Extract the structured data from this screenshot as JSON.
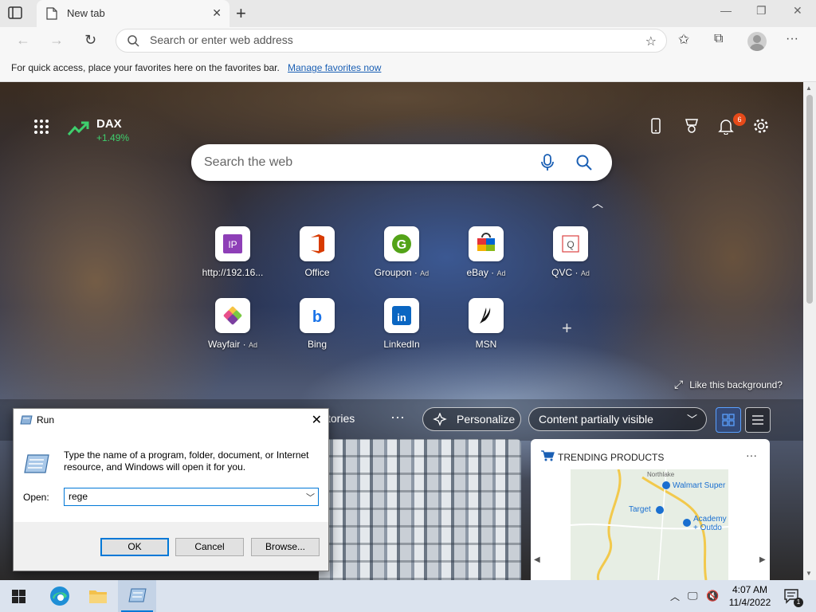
{
  "browser": {
    "tab_title": "New tab",
    "tab_close": "✕",
    "new_tab": "+",
    "address_placeholder": "Search or enter web address",
    "favorites_message": "For quick access, place your favorites here on the favorites bar.",
    "manage_favorites": "Manage favorites now",
    "window": {
      "minimize": "—",
      "restore": "❐",
      "close": "✕"
    },
    "more_menu": "···"
  },
  "newtab": {
    "ticker": {
      "name": "DAX",
      "change": "+1.49%"
    },
    "notification_count": "6",
    "search_placeholder": "Search the web",
    "quick_links": [
      {
        "label": "http://192.16...",
        "ad": "",
        "icon": "ip-icon"
      },
      {
        "label": "Office",
        "ad": "",
        "icon": "office-icon"
      },
      {
        "label": "Groupon",
        "ad": "Ad",
        "icon": "groupon-icon"
      },
      {
        "label": "eBay",
        "ad": "Ad",
        "icon": "ebay-icon"
      },
      {
        "label": "QVC",
        "ad": "Ad",
        "icon": "qvc-icon"
      },
      {
        "label": "Wayfair",
        "ad": "Ad",
        "icon": "wayfair-icon"
      },
      {
        "label": "Bing",
        "ad": "",
        "icon": "bing-icon"
      },
      {
        "label": "LinkedIn",
        "ad": "",
        "icon": "linkedin-icon"
      },
      {
        "label": "MSN",
        "ad": "",
        "icon": "msn-icon"
      }
    ],
    "add_quick_link": "+",
    "like_background": "Like this background?",
    "feed": {
      "stories_label": "tories",
      "more": "···",
      "personalize": "Personalize",
      "content_visibility": "Content partially visible"
    },
    "trending": {
      "title": "TRENDING PRODUCTS",
      "more": "···",
      "map_labels": [
        "Walmart Super",
        "Target",
        "Academy",
        "+ Outdo",
        "Northlake"
      ]
    }
  },
  "run_dialog": {
    "title": "Run",
    "close": "✕",
    "description": "Type the name of a program, folder, document, or Internet resource, and Windows will open it for you.",
    "open_label": "Open:",
    "open_value": "rege",
    "ok": "OK",
    "cancel": "Cancel",
    "browse": "Browse..."
  },
  "taskbar": {
    "time": "4:07 AM",
    "date": "11/4/2022",
    "notification_badge": "1"
  },
  "colors": {
    "accent": "#0078d7",
    "ticker_up": "#3ecf6d",
    "badge": "#e64a19"
  }
}
